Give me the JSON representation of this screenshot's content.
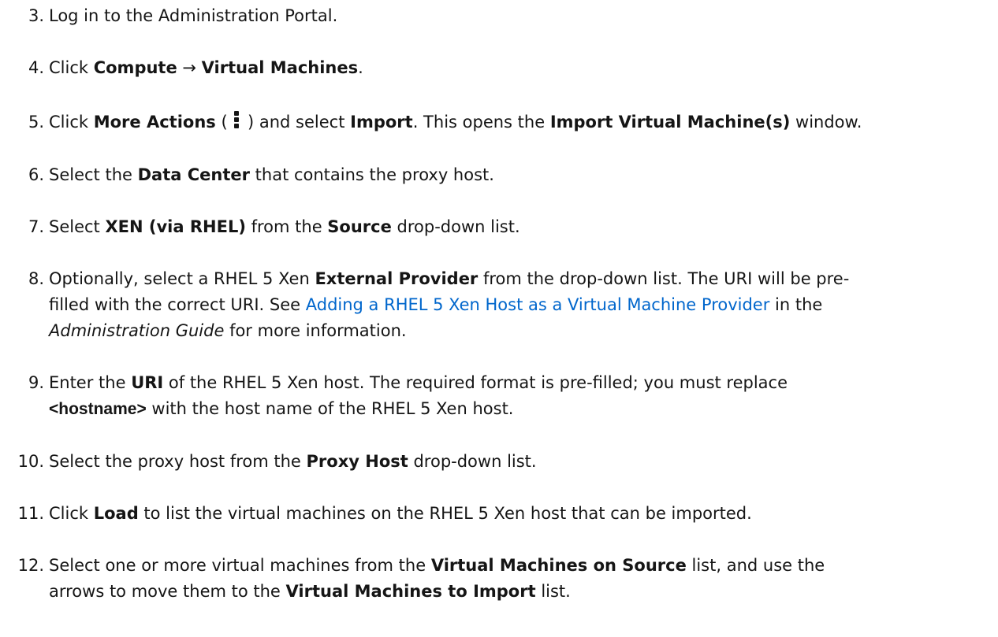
{
  "steps": [
    {
      "num": "3.",
      "parts": {
        "t1": "Log in to the Administration Portal."
      }
    },
    {
      "num": "4.",
      "parts": {
        "t1": "Click ",
        "b1": "Compute",
        "t2": " → ",
        "b2": "Virtual Machines",
        "t3": "."
      }
    },
    {
      "num": "5.",
      "parts": {
        "t1": "Click ",
        "b1": "More Actions",
        "t2": " ( ",
        "t3": " ) and select ",
        "b2": "Import",
        "t4": ". This opens the ",
        "b3": "Import Virtual Machine(s)",
        "t5": " window."
      }
    },
    {
      "num": "6.",
      "parts": {
        "t1": "Select the ",
        "b1": "Data Center",
        "t2": " that contains the proxy host."
      }
    },
    {
      "num": "7.",
      "parts": {
        "t1": "Select ",
        "b1": "XEN (via RHEL)",
        "t2": " from the ",
        "b2": "Source",
        "t3": " drop-down list."
      }
    },
    {
      "num": "8.",
      "parts": {
        "t1": "Optionally, select a RHEL 5 Xen ",
        "b1": "External Provider",
        "t2": " from the drop-down list. The URI will be pre-",
        "t3": "filled with the correct URI. See ",
        "link": "Adding a RHEL 5 Xen Host as a Virtual Machine Provider",
        "t4": "  in the",
        "em": "Administration Guide",
        "t5": " for more information."
      }
    },
    {
      "num": "9.",
      "parts": {
        "t1": "Enter the ",
        "b1": "URI",
        "t2": " of the RHEL 5 Xen host. The required format is pre-filled; you must replace",
        "code": "<hostname>",
        "t3": " with the host name of the RHEL 5 Xen host."
      }
    },
    {
      "num": "10.",
      "parts": {
        "t1": "Select the proxy host from the ",
        "b1": "Proxy Host",
        "t2": " drop-down list."
      }
    },
    {
      "num": "11.",
      "parts": {
        "t1": "Click ",
        "b1": "Load",
        "t2": " to list the virtual machines on the RHEL 5 Xen host that can be imported."
      }
    },
    {
      "num": "12.",
      "parts": {
        "t1": "Select one or more virtual machines from the ",
        "b1": "Virtual Machines on Source",
        "t2": " list, and use the",
        "t3": "arrows to move them to the ",
        "b2": "Virtual Machines to Import",
        "t4": " list."
      }
    }
  ]
}
